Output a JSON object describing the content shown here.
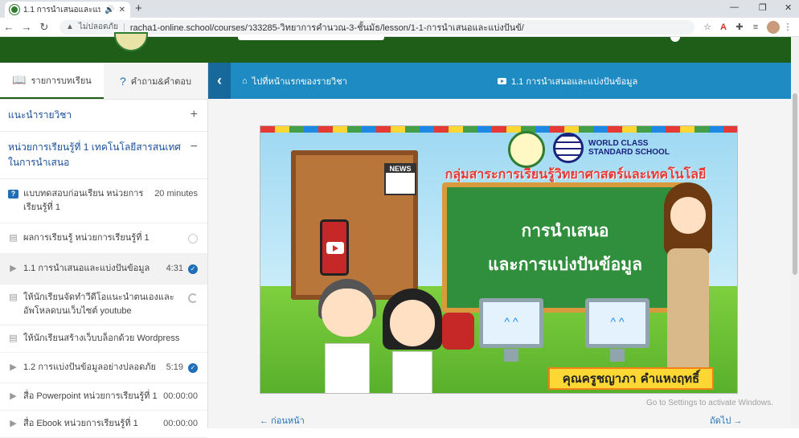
{
  "browser": {
    "tab_title": "1.1 การนำเสนอและแบ่งปันข้อมูล",
    "security_label": "ไม่ปลอดภัย",
    "url": "racha1-online.school/courses/ว33285-วิทยาการคำนวณ-3-ชั้นมัธ/lesson/1-1-การนำเสนอและแบ่งปันข้/"
  },
  "sidebar": {
    "tabs": [
      {
        "label": "รายการบทเรียน",
        "icon": "book-icon",
        "active": true
      },
      {
        "label": "คำถาม&คำตอบ",
        "icon": "question-icon",
        "active": false
      }
    ],
    "intro_section": {
      "title": "แนะนำรายวิชา",
      "toggle": "+"
    },
    "unit_section": {
      "title": "หน่วยการเรียนรู้ที่ 1 เทคโนโลยีสารสนเทศ ในการนำเสนอ",
      "toggle": "−"
    },
    "items": [
      {
        "type": "quiz",
        "type_glyph": "?",
        "label": "แบบทดสอบก่อนเรียน หน่วยการเรียนรู้ที่ 1",
        "meta": "20 minutes",
        "status": "none",
        "status_glyph": ""
      },
      {
        "type": "page",
        "type_glyph": "▤",
        "label": "ผลการเรียนรู้ หน่วยการเรียนรู้ที่ 1",
        "meta": "",
        "status": "open",
        "status_glyph": ""
      },
      {
        "type": "video",
        "type_glyph": "▶",
        "label": "1.1 การนำเสนอและแบ่งปันข้อมูล",
        "meta": "4:31",
        "status": "done",
        "status_glyph": "✓"
      },
      {
        "type": "assignment",
        "type_glyph": "▤",
        "label": "ให้นักเรียนจัดทำวีดีโอแนะนำตนเองและอัพโหลดบนเว็บไซต์ youtube",
        "meta": "",
        "status": "partial",
        "status_glyph": ""
      },
      {
        "type": "assignment",
        "type_glyph": "▤",
        "label": "ให้นักเรียนสร้างเว็บบล็อกด้วย Wordpress",
        "meta": "",
        "status": "none",
        "status_glyph": ""
      },
      {
        "type": "video",
        "type_glyph": "▶",
        "label": "1.2 การแบ่งปันข้อมูลอย่างปลอดภัย",
        "meta": "5:19",
        "status": "done",
        "status_glyph": "✓"
      },
      {
        "type": "video",
        "type_glyph": "▶",
        "label": "สื่อ Powerpoint หน่วยการเรียนรู้ที่ 1",
        "meta": "00:00:00",
        "status": "none",
        "status_glyph": ""
      },
      {
        "type": "video",
        "type_glyph": "▶",
        "label": "สื่อ Ebook หน่วยการเรียนรู้ที่ 1",
        "meta": "00:00:00",
        "status": "none",
        "status_glyph": ""
      }
    ]
  },
  "topbar": {
    "back_glyph": "‹",
    "home_label": "ไปที่หน้าแรกของรายวิชา",
    "lesson_title": "1.1 การนำเสนอและแบ่งปันข้อมูล"
  },
  "video": {
    "heading": "กลุ่มสาระการเรียนรู้วิทยาศาสตร์และเทคโนโลยี",
    "board_line1": "การนำเสนอ",
    "board_line2": "และการแบ่งปันข้อมูล",
    "presenter": "คุณครูชญาภา คำแหงฤทธิ์",
    "logo_text_1": "WORLD CLASS",
    "logo_text_2": "STANDARD SCHOOL",
    "news_label": "NEWS"
  },
  "nav": {
    "prev": "← ก่อนหน้า",
    "next": "ถัดไป →"
  },
  "watermark": "Go to Settings to activate Windows."
}
